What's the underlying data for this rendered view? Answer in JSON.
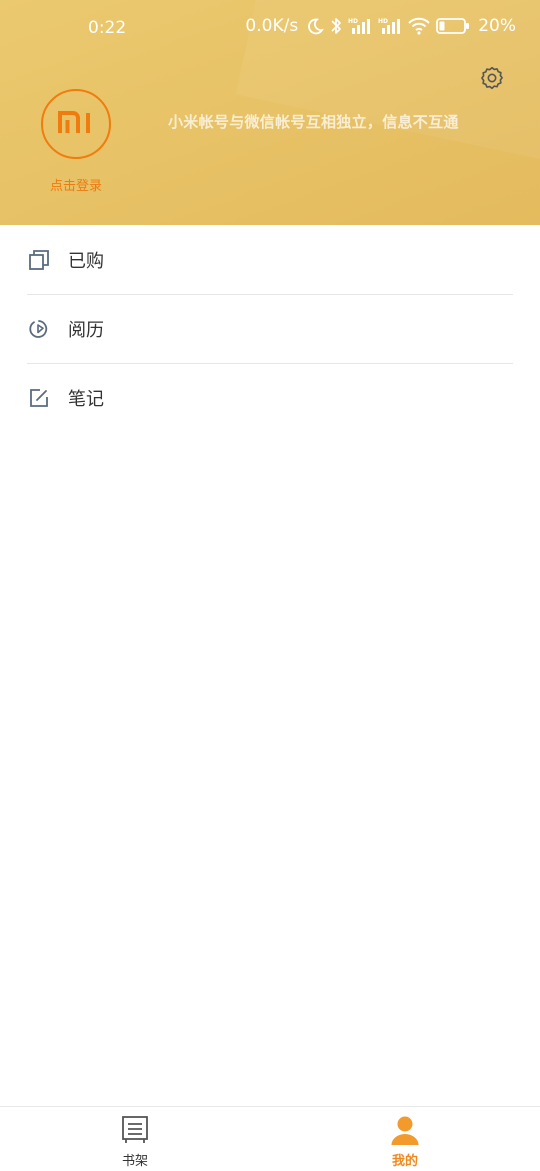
{
  "status_bar": {
    "time": "0:22",
    "network_speed": "0.0K/s",
    "battery": "20%",
    "icons": [
      "moon-icon",
      "bluetooth-icon",
      "hd-signal-icon",
      "hd-signal-icon",
      "wifi-icon",
      "battery-icon"
    ]
  },
  "header": {
    "settings_icon": "gear-icon",
    "avatar_icon": "mi-logo",
    "login_label": "点击登录",
    "notice": "小米帐号与微信帐号互相独立，信息不互通",
    "background_color": "#e7c165",
    "accent_color": "#f07c0f"
  },
  "menu": {
    "items": [
      {
        "label": "已购",
        "icon": "purchased-icon"
      },
      {
        "label": "阅历",
        "icon": "reading-history-icon"
      },
      {
        "label": "笔记",
        "icon": "note-edit-icon"
      }
    ]
  },
  "tabbar": {
    "tabs": [
      {
        "label": "书架",
        "icon": "bookshelf-icon",
        "active": false
      },
      {
        "label": "我的",
        "icon": "person-icon",
        "active": true
      }
    ],
    "active_color": "#f08a1f"
  }
}
